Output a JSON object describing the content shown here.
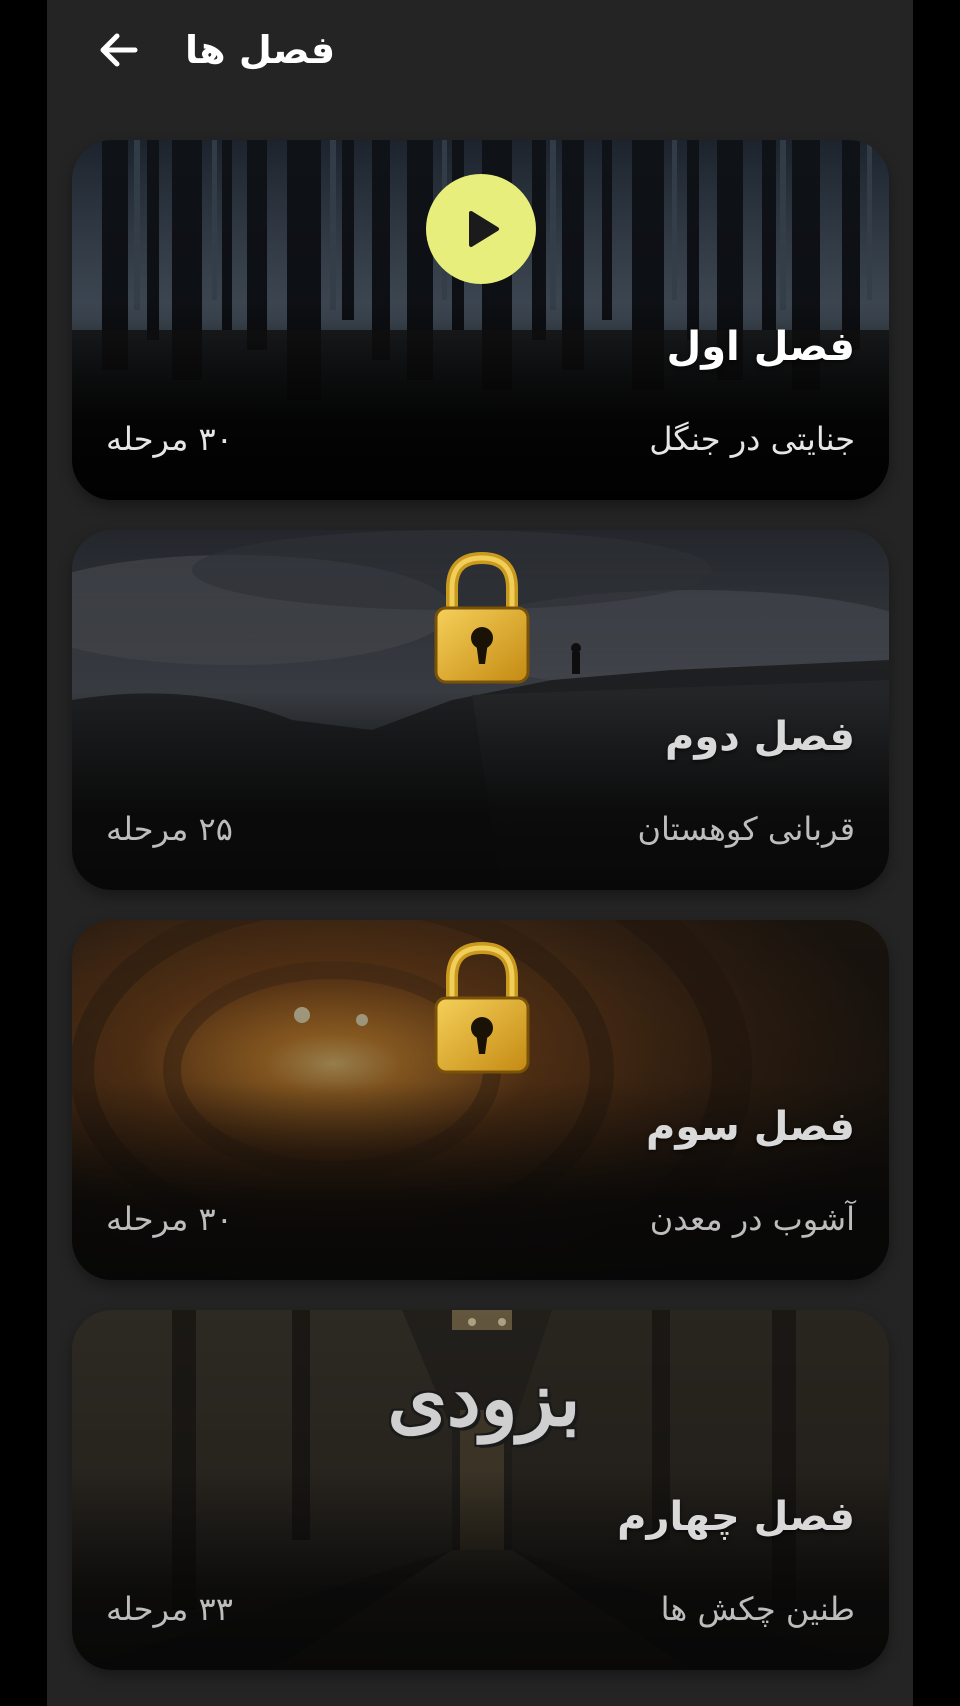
{
  "header": {
    "title": "فصل ها",
    "back_icon": "arrow-left-icon"
  },
  "chapters": [
    {
      "title": "فصل اول",
      "subtitle": "جنایتی در جنگل",
      "levels": "۳۰ مرحله",
      "status": "play",
      "status_icon": "play-icon",
      "accent": "#e7ee7c"
    },
    {
      "title": "فصل دوم",
      "subtitle": "قربانی کوهستان",
      "levels": "۲۵ مرحله",
      "status": "locked",
      "status_icon": "lock-icon"
    },
    {
      "title": "فصل سوم",
      "subtitle": "آشوب در معدن",
      "levels": "۳۰ مرحله",
      "status": "locked",
      "status_icon": "lock-icon"
    },
    {
      "title": "فصل چهارم",
      "subtitle": "طنین چکش ها",
      "levels": "۳۳ مرحله",
      "status": "coming-soon",
      "badge": "بزودی"
    }
  ]
}
